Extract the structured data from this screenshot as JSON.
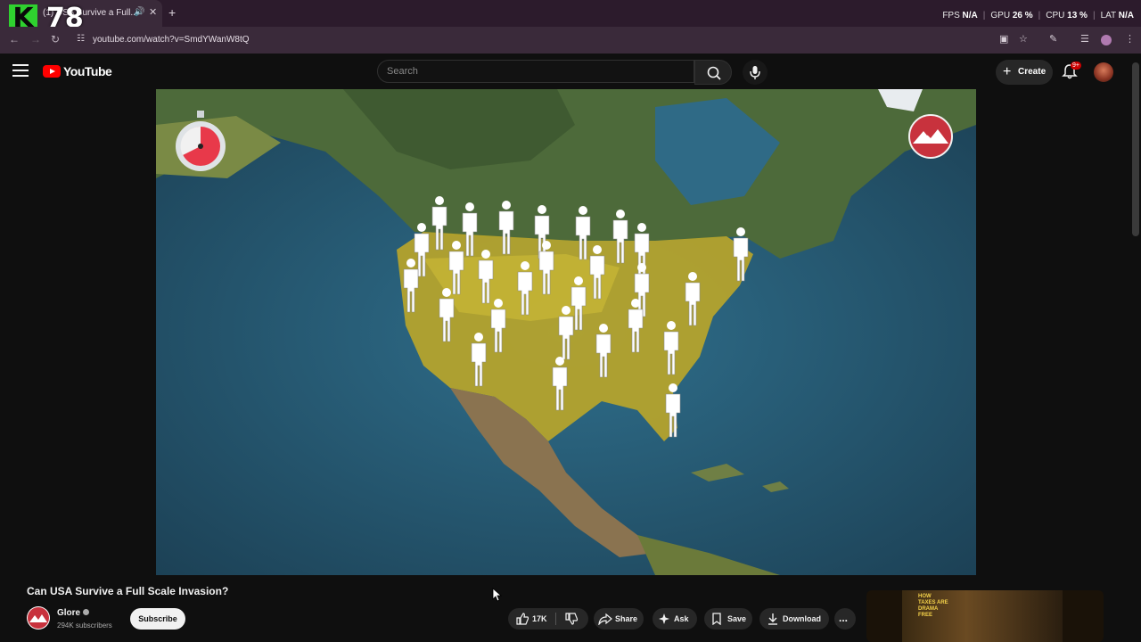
{
  "browser": {
    "tab_title": "(1) USA Survive a Full...",
    "url": "youtube.com/watch?v=SmdYWanW8tQ",
    "overlay_letter": "K",
    "overlay_fps": "78",
    "perf": [
      {
        "label": "FPS",
        "value": "N/A"
      },
      {
        "label": "GPU",
        "value": "26 %"
      },
      {
        "label": "CPU",
        "value": "13 %"
      },
      {
        "label": "LAT",
        "value": "N/A"
      }
    ]
  },
  "header": {
    "logo_text": "YouTube",
    "search_placeholder": "Search",
    "create_label": "Create",
    "notification_badge": "9+"
  },
  "video": {
    "title": "Can USA Survive a Full Scale Invasion?",
    "channel_name": "Glore",
    "subscribers": "294K subscribers",
    "subscribe_label": "Subscribe",
    "likes": "17K",
    "share_label": "Share",
    "ask_label": "Ask",
    "save_label": "Save",
    "download_label": "Download",
    "more_label": "..."
  },
  "next_thumbnail": {
    "text": "HOW TAXES ARE DRAMA FREE"
  },
  "colors": {
    "brand_red": "#ff0000",
    "page_bg": "#0f0f0f",
    "pill_bg": "#272727",
    "overlay_green": "#2fd12f"
  }
}
